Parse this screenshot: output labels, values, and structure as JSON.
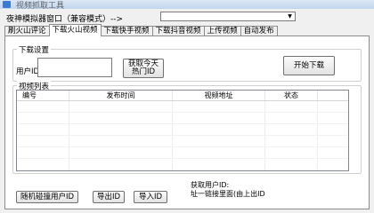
{
  "window": {
    "title": "视频抓取工具"
  },
  "emulator": {
    "label": "夜神模拟器窗口（兼容模式）-->",
    "selected": ""
  },
  "tabs": [
    {
      "label": "刷火山评论",
      "active": false
    },
    {
      "label": "下载火山视频",
      "active": true
    },
    {
      "label": "下载快手视频",
      "active": false
    },
    {
      "label": "下载抖音视频",
      "active": false
    },
    {
      "label": "上传视频",
      "active": false
    },
    {
      "label": "自动发布",
      "active": false
    }
  ],
  "download_settings": {
    "legend": "下载设置",
    "user_id_label": "用户ID:",
    "user_id_value": "",
    "hot_id_button": "获取今天\n热门ID",
    "start_button": "开始下载"
  },
  "video_list": {
    "legend": "视频列表",
    "columns": [
      "编号",
      "发布时间",
      "视频地址",
      "状态"
    ]
  },
  "bottom": {
    "random_button": "随机碰撞用户ID",
    "export_button": "导出ID",
    "import_button": "导入ID",
    "get_user_label": "获取用户ID:",
    "get_user_sub": "址一链接里面(由上出ID"
  }
}
